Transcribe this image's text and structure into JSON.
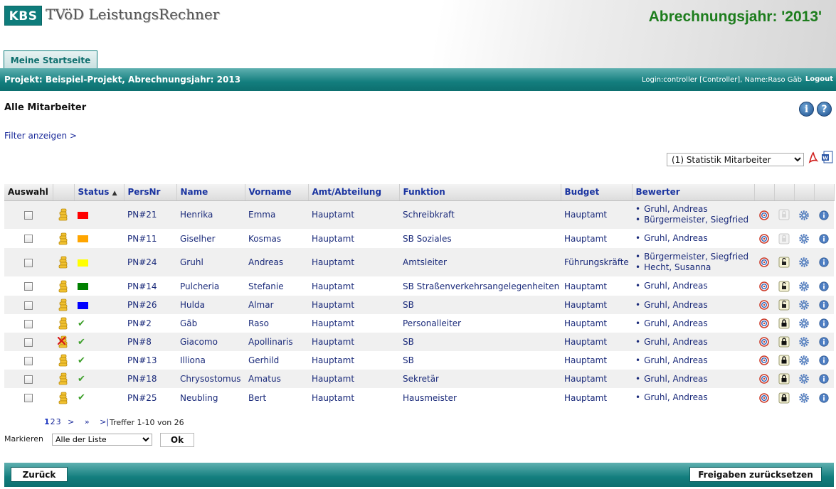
{
  "header": {
    "logo": "KBS",
    "app_name": "TVöD LeistungsRechner",
    "year_title": "Abrechnungsjahr: '2013'",
    "tab": "Meine Startseite"
  },
  "project_bar": {
    "project": "Projekt: Beispiel-Projekt, Abrechnungsjahr: 2013",
    "login": "Login:controller [Controller], Name:Raso Gäb",
    "logout": "Logout"
  },
  "main": {
    "title": "Alle Mitarbeiter",
    "filter_link": "Filter anzeigen >",
    "stat_select": "(1) Statistik Mitarbeiter",
    "info_icon": "i",
    "help_icon": "?"
  },
  "columns": {
    "auswahl": "Auswahl",
    "status": "Status",
    "sort_indicator": "▲",
    "persnr": "PersNr",
    "name": "Name",
    "vorname": "Vorname",
    "amt": "Amt/Abteilung",
    "funktion": "Funktion",
    "budget": "Budget",
    "bewerter": "Bewerter"
  },
  "colors": {
    "red": "#ff0000",
    "orange": "#ffa500",
    "yellow": "#ffff00",
    "green": "#008000",
    "blue": "#0000ff",
    "teal": "#0e7c7b",
    "title_green": "#1d7d1d"
  },
  "rows": [
    {
      "persnr": "PN#21",
      "name": "Henrika",
      "vorname": "Emma",
      "amt": "Hauptamt",
      "funktion": "Schreibkraft",
      "budget": "Hauptamt",
      "bewerter": [
        "Gruhl, Andreas",
        "Bürgermeister, Siegfried"
      ],
      "status": "square",
      "status_color": "#ff0000",
      "coin_icon": "coins",
      "lock": "lock-disabled"
    },
    {
      "persnr": "PN#11",
      "name": "Giselher",
      "vorname": "Kosmas",
      "amt": "Hauptamt",
      "funktion": "SB Soziales",
      "budget": "Hauptamt",
      "bewerter": [
        "Gruhl, Andreas"
      ],
      "status": "square",
      "status_color": "#ffa500",
      "coin_icon": "coins",
      "lock": "lock-disabled"
    },
    {
      "persnr": "PN#24",
      "name": "Gruhl",
      "vorname": "Andreas",
      "amt": "Hauptamt",
      "funktion": "Amtsleiter",
      "budget": "Führungskräfte",
      "bewerter": [
        "Bürgermeister, Siegfried",
        "Hecht, Susanna"
      ],
      "status": "square",
      "status_color": "#ffff00",
      "coin_icon": "coins",
      "lock": "lock-open"
    },
    {
      "persnr": "PN#14",
      "name": "Pulcheria",
      "vorname": "Stefanie",
      "amt": "Hauptamt",
      "funktion": "SB Straßenverkehrsangelegenheiten",
      "budget": "Hauptamt",
      "bewerter": [
        "Gruhl, Andreas"
      ],
      "status": "square",
      "status_color": "#008000",
      "coin_icon": "coins",
      "lock": "lock-open"
    },
    {
      "persnr": "PN#26",
      "name": "Hulda",
      "vorname": "Almar",
      "amt": "Hauptamt",
      "funktion": "SB",
      "budget": "Hauptamt",
      "bewerter": [
        "Gruhl, Andreas"
      ],
      "status": "square",
      "status_color": "#0000ff",
      "coin_icon": "coins",
      "lock": "lock-open"
    },
    {
      "persnr": "PN#2",
      "name": "Gäb",
      "vorname": "Raso",
      "amt": "Hauptamt",
      "funktion": "Personalleiter",
      "budget": "Hauptamt",
      "bewerter": [
        "Gruhl, Andreas"
      ],
      "status": "check",
      "status_color": "#3d9f2a",
      "coin_icon": "coins",
      "lock": "lock-closed"
    },
    {
      "persnr": "PN#8",
      "name": "Giacomo",
      "vorname": "Apollinaris",
      "amt": "Hauptamt",
      "funktion": "SB",
      "budget": "Hauptamt",
      "bewerter": [
        "Gruhl, Andreas"
      ],
      "status": "check",
      "status_color": "#3d9f2a",
      "coin_icon": "coins-crossed",
      "lock": "lock-closed"
    },
    {
      "persnr": "PN#13",
      "name": "Illiona",
      "vorname": "Gerhild",
      "amt": "Hauptamt",
      "funktion": "SB",
      "budget": "Hauptamt",
      "bewerter": [
        "Gruhl, Andreas"
      ],
      "status": "check",
      "status_color": "#3d9f2a",
      "coin_icon": "coins",
      "lock": "lock-closed"
    },
    {
      "persnr": "PN#18",
      "name": "Chrysostomus",
      "vorname": "Amatus",
      "amt": "Hauptamt",
      "funktion": "Sekretär",
      "budget": "Hauptamt",
      "bewerter": [
        "Gruhl, Andreas"
      ],
      "status": "check",
      "status_color": "#3d9f2a",
      "coin_icon": "coins",
      "lock": "lock-closed"
    },
    {
      "persnr": "PN#25",
      "name": "Neubling",
      "vorname": "Bert",
      "amt": "Hauptamt",
      "funktion": "Hausmeister",
      "budget": "Hauptamt",
      "bewerter": [
        "Gruhl, Andreas"
      ],
      "status": "check",
      "status_color": "#3d9f2a",
      "coin_icon": "coins",
      "lock": "lock-closed"
    }
  ],
  "row_icons": [
    "target-icon",
    "lock-icon",
    "gear-icon",
    "info-icon"
  ],
  "pager": {
    "pages": [
      "1",
      "2",
      "3"
    ],
    "current": "1",
    "next": ">",
    "next_block": "»",
    "last": ">|",
    "hits": "Treffer 1-10 von 26"
  },
  "mark": {
    "label": "Markieren",
    "select": "Alle der Liste",
    "ok": "Ok"
  },
  "footer": {
    "back": "Zurück",
    "reset": "Freigaben zurücksetzen"
  }
}
